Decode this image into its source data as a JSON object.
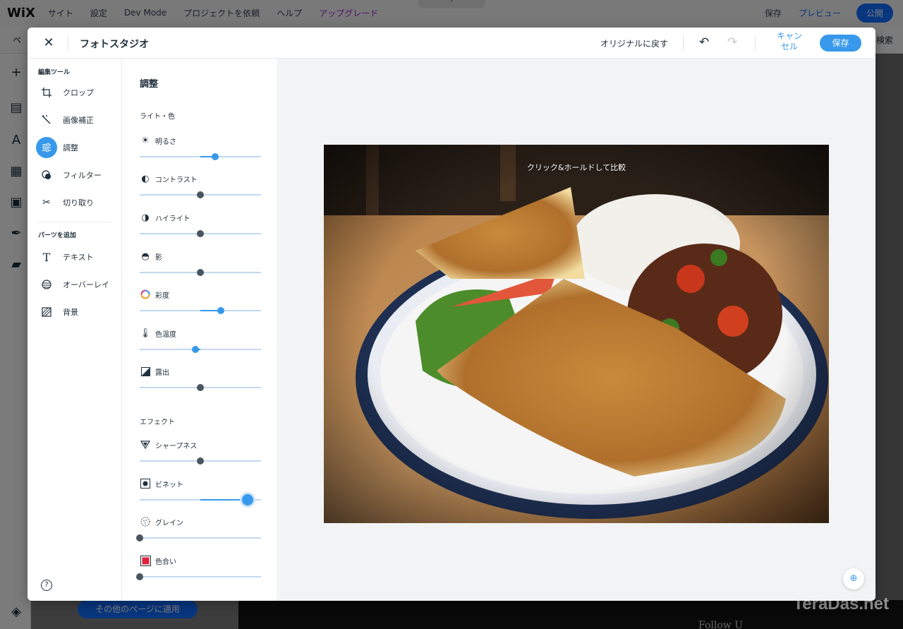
{
  "editor": {
    "logo": "WiX",
    "menu": [
      "サイト",
      "設定",
      "Dev Mode",
      "プロジェクトを依頼",
      "ヘルプ",
      "アップグレード"
    ],
    "save": "保存",
    "preview": "プレビュー",
    "publish": "公開",
    "pages_label": "ペ",
    "search_label": "検索",
    "apply_all": "その他のページに適用",
    "footer_text": "Follow U"
  },
  "watermark": "TeraDas.net",
  "studio": {
    "title": "フォトスタジオ",
    "revert": "オリジナルに戻す",
    "cancel": "キャンセル",
    "save": "保存",
    "tools_section": "編集ツール",
    "tools": [
      {
        "label": "クロップ",
        "icon": "crop-icon"
      },
      {
        "label": "画像補正",
        "icon": "magic-wand-icon"
      },
      {
        "label": "調整",
        "icon": "sliders-icon"
      },
      {
        "label": "フィルター",
        "icon": "filter-icon"
      },
      {
        "label": "切り取り",
        "icon": "scissors-icon"
      }
    ],
    "parts_section": "パーツを追加",
    "parts": [
      {
        "label": "テキスト",
        "icon": "text-icon"
      },
      {
        "label": "オーバーレイ",
        "icon": "overlay-icon"
      },
      {
        "label": "背景",
        "icon": "background-icon"
      }
    ],
    "help": "?",
    "adjust": {
      "title": "調整",
      "light_color": "ライト・色",
      "effects": "エフェクト",
      "controls": [
        {
          "label": "明るさ",
          "icon": "brightness-icon",
          "value": 0.62
        },
        {
          "label": "コントラスト",
          "icon": "contrast-icon",
          "value": 0.5
        },
        {
          "label": "ハイライト",
          "icon": "highlight-icon",
          "value": 0.5
        },
        {
          "label": "影",
          "icon": "shadow-icon",
          "value": 0.5
        },
        {
          "label": "彩度",
          "icon": "saturation-icon",
          "value": 0.67
        },
        {
          "label": "色温度",
          "icon": "temperature-icon",
          "value": 0.46
        },
        {
          "label": "露出",
          "icon": "exposure-icon",
          "value": 0.5
        },
        {
          "label": "シャープネス",
          "icon": "sharpness-icon",
          "value": 0.5
        },
        {
          "label": "ビネット",
          "icon": "vignette-icon",
          "value": 0.89
        },
        {
          "label": "グレイン",
          "icon": "grain-icon",
          "value": 0.0
        },
        {
          "label": "色合い",
          "icon": "tint-icon",
          "value": 0.0
        }
      ]
    },
    "compare_hint": "クリック&ホールドして比較"
  },
  "colors": {
    "accent": "#3899ec",
    "wix_blue": "#116dff",
    "tint_swatch": "#e0223b"
  }
}
